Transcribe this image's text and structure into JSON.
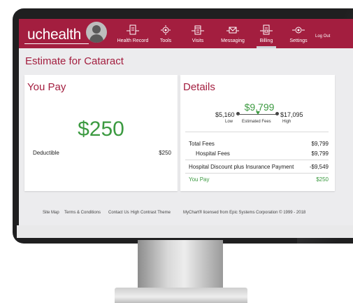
{
  "app": {
    "logo": "uchealth"
  },
  "nav": {
    "items": [
      {
        "label": "Health Record",
        "icon": "health-record-icon"
      },
      {
        "label": "Tools",
        "icon": "tools-icon"
      },
      {
        "label": "Visits",
        "icon": "calendar-icon"
      },
      {
        "label": "Messaging",
        "icon": "envelope-icon"
      },
      {
        "label": "Billing",
        "icon": "billing-icon",
        "active": true
      },
      {
        "label": "Settings",
        "icon": "gear-icon"
      }
    ],
    "logout": "Log Out"
  },
  "page": {
    "title": "Estimate for Cataract"
  },
  "you_pay": {
    "title": "You Pay",
    "amount": "$250",
    "deductible_label": "Deductible",
    "deductible_value": "$250"
  },
  "details": {
    "title": "Details",
    "estimate": "$9,799",
    "low": "$5,160",
    "high": "$17,095",
    "low_label": "Low",
    "estimated_label": "Estimated Fees",
    "high_label": "High",
    "rows": [
      {
        "label": "Total Fees",
        "value": "$9,799"
      },
      {
        "label": "Hospital Fees",
        "value": "$9,799"
      },
      {
        "label": "Hospital Discount plus Insurance Payment",
        "value": "-$9,549"
      },
      {
        "label": "You Pay",
        "value": "$250"
      }
    ]
  },
  "footer": {
    "links": [
      "Site Map",
      "Terms & Conditions",
      "Contact Us",
      "High Contrast Theme"
    ],
    "copyright": "MyChart® licensed from Epic Systems Corporation © 1999 - 2018"
  },
  "colors": {
    "brand": "#a31e3f",
    "positive": "#3c9a41"
  }
}
